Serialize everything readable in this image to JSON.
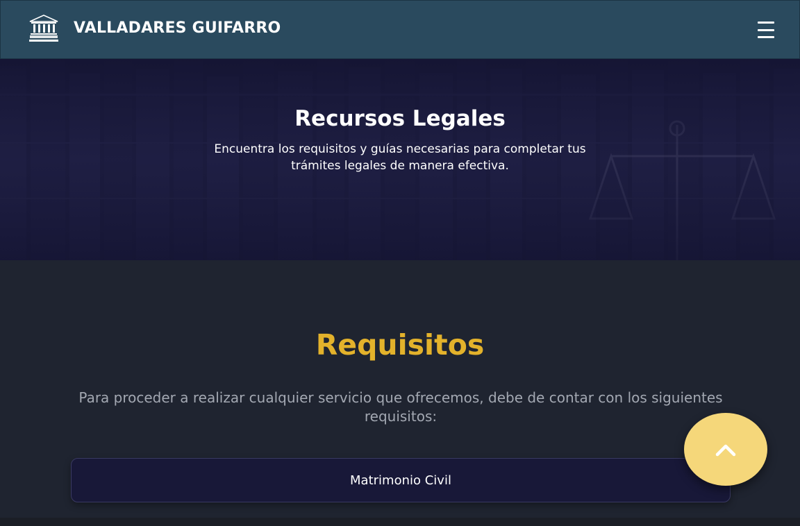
{
  "header": {
    "brand": "VALLADARES GUIFARRO",
    "logo_icon": "courthouse-logo-icon",
    "menu_icon": "hamburger-menu-icon"
  },
  "hero": {
    "title": "Recursos Legales",
    "subtitle": "Encuentra los requisitos y guías necesarias para completar tus trámites legales de manera efectiva."
  },
  "requisitos": {
    "title": "Requisitos",
    "description": "Para proceder a realizar cualquier servicio que ofrecemos, debe de contar con los siguientes requisitos:",
    "items": [
      {
        "label": "Matrimonio Civil"
      }
    ]
  },
  "scroll_top": {
    "icon": "chevron-up-icon"
  },
  "colors": {
    "header_bg": "#2a4a5e",
    "hero_bg": "#181838",
    "page_bg": "#1f2430",
    "accent_gold": "#e3b22b",
    "scroll_button": "#f5d77a"
  }
}
